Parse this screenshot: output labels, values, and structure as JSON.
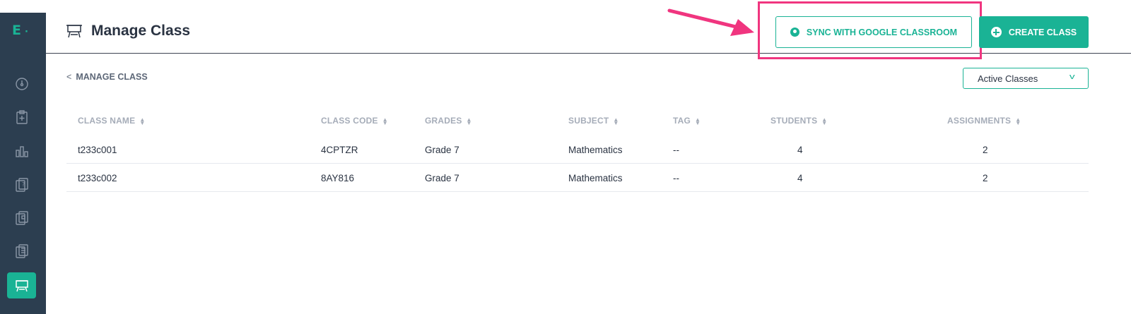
{
  "sidebar": {
    "logo_letter": "E",
    "logo_dot": "·",
    "items": [
      {
        "name": "dashboard-icon"
      },
      {
        "name": "assignment-add-icon"
      },
      {
        "name": "reports-icon"
      },
      {
        "name": "question-bank-icon"
      },
      {
        "name": "test-library-icon"
      },
      {
        "name": "playlist-icon"
      },
      {
        "name": "manage-class-icon",
        "active": true
      }
    ]
  },
  "header": {
    "title": "Manage Class",
    "sync_label": "SYNC WITH GOOGLE CLASSROOM",
    "create_label": "CREATE CLASS"
  },
  "breadcrumb": {
    "chevron": "<",
    "label": "MANAGE CLASS"
  },
  "filter": {
    "selected": "Active Classes"
  },
  "table": {
    "columns": [
      "CLASS NAME",
      "CLASS CODE",
      "GRADES",
      "SUBJECT",
      "TAG",
      "STUDENTS",
      "ASSIGNMENTS"
    ],
    "rows": [
      [
        "t233c001",
        "4CPTZR",
        "Grade 7",
        "Mathematics",
        "--",
        "4",
        "2"
      ],
      [
        "t233c002",
        "8AY816",
        "Grade 7",
        "Mathematics",
        "--",
        "4",
        "2"
      ]
    ]
  },
  "colors": {
    "accent": "#1ab395",
    "sidebar_bg": "#2c3e50",
    "highlight": "#f0357f"
  }
}
